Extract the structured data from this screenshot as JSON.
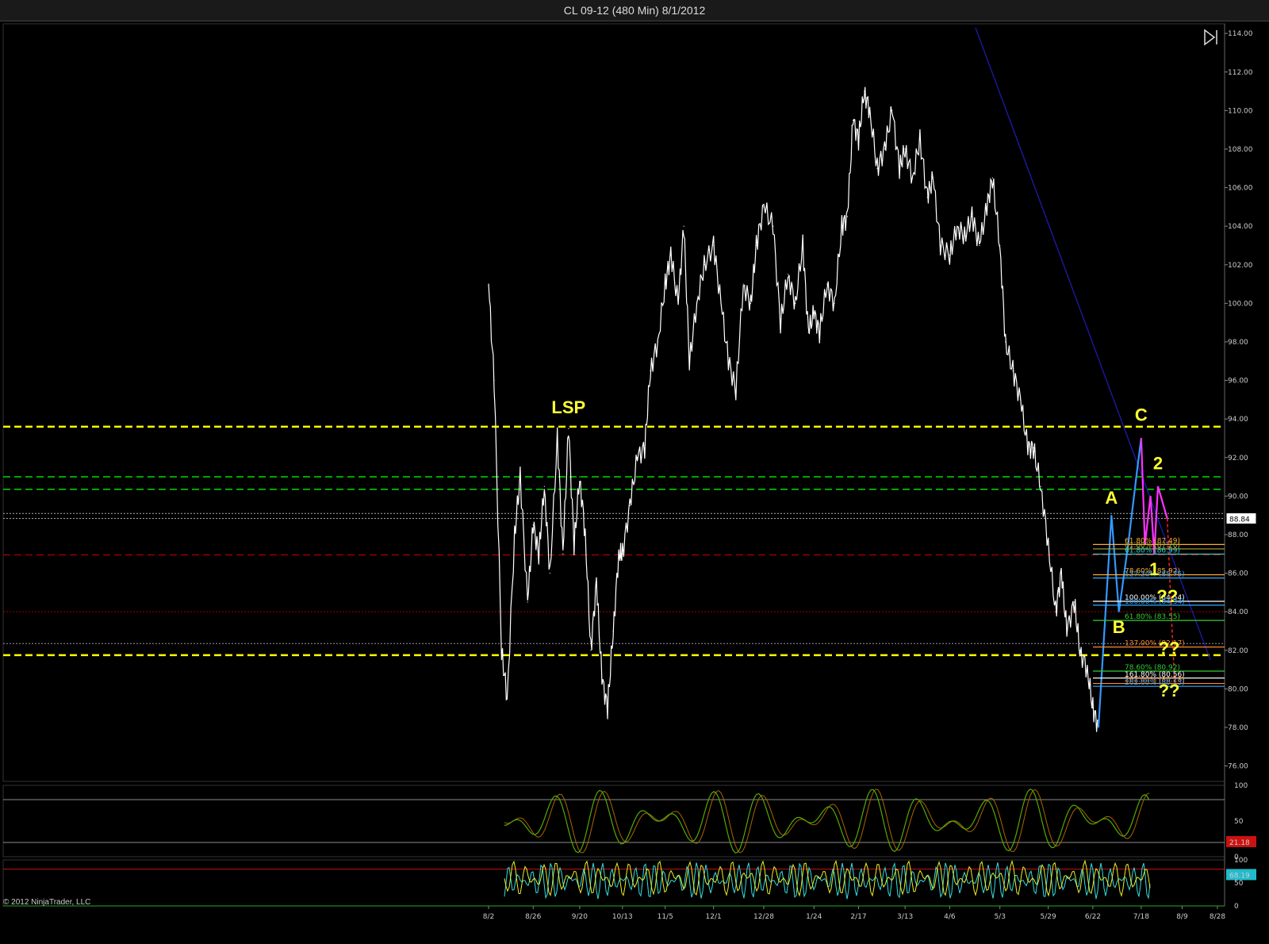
{
  "window": {
    "title": "CL 09-12 (480 Min)  8/1/2012"
  },
  "copyright": "© 2012 NinjaTrader, LLC",
  "colors": {
    "background": "#000000",
    "price": "#ffffff",
    "yellow_level": "#ffff00",
    "green_level": "#00cc00",
    "red_level": "#cc0000",
    "trendline": "#1a1aa0",
    "wave_blue": "#3399ff",
    "wave_magenta": "#ff33ff",
    "stoch_green": "#55aa00",
    "stoch_orange": "#aa6600",
    "cyan": "#33dddd"
  },
  "chart_data": [
    {
      "type": "line",
      "panel": "price",
      "x_tick_labels": [
        "8/2",
        "8/26",
        "9/20",
        "10/13",
        "11/5",
        "12/1",
        "12/28",
        "1/24",
        "2/17",
        "3/13",
        "4/6",
        "5/3",
        "5/29",
        "6/22",
        "7/18",
        "8/9",
        "8/28"
      ],
      "y_tick_labels": [
        "114.00",
        "112.00",
        "110.00",
        "108.00",
        "106.00",
        "104.00",
        "102.00",
        "100.00",
        "98.00",
        "96.00",
        "94.00",
        "92.00",
        "90.00",
        "88.00",
        "86.00",
        "84.00",
        "82.00",
        "80.00",
        "78.00",
        "76.00"
      ],
      "ylim": [
        75.2,
        114.5
      ],
      "last_price": "88.84",
      "series": [
        {
          "color": "#ffffff",
          "points": [
            [
              "8/2",
              101.0
            ],
            [
              "8/5",
              96.0
            ],
            [
              "8/9",
              82.0
            ],
            [
              "8/12",
              79.5
            ],
            [
              "8/16",
              88.0
            ],
            [
              "8/19",
              91.0
            ],
            [
              "8/23",
              84.5
            ],
            [
              "8/26",
              88.5
            ],
            [
              "8/29",
              87.0
            ],
            [
              "9/1",
              90.5
            ],
            [
              "9/4",
              86.0
            ],
            [
              "9/8",
              93.0
            ],
            [
              "9/11",
              87.0
            ],
            [
              "9/14",
              93.5
            ],
            [
              "9/17",
              87.5
            ],
            [
              "9/20",
              91.0
            ],
            [
              "9/23",
              88.0
            ],
            [
              "9/26",
              82.0
            ],
            [
              "9/29",
              85.5
            ],
            [
              "10/2",
              80.5
            ],
            [
              "10/5",
              79.0
            ],
            [
              "10/8",
              83.0
            ],
            [
              "10/11",
              87.0
            ],
            [
              "10/13",
              87.0
            ],
            [
              "10/17",
              89.5
            ],
            [
              "10/21",
              92.0
            ],
            [
              "10/25",
              92.5
            ],
            [
              "10/28",
              96.5
            ],
            [
              "11/1",
              98.0
            ],
            [
              "11/5",
              101.0
            ],
            [
              "11/8",
              102.5
            ],
            [
              "11/12",
              100.0
            ],
            [
              "11/15",
              104.0
            ],
            [
              "11/18",
              97.0
            ],
            [
              "11/22",
              100.0
            ],
            [
              "11/26",
              102.0
            ],
            [
              "12/1",
              103.0
            ],
            [
              "12/5",
              100.0
            ],
            [
              "12/9",
              97.0
            ],
            [
              "12/13",
              95.5
            ],
            [
              "12/17",
              101.0
            ],
            [
              "12/21",
              100.0
            ],
            [
              "12/24",
              103.0
            ],
            [
              "12/28",
              105.0
            ],
            [
              "1/2",
              104.0
            ],
            [
              "1/6",
              99.0
            ],
            [
              "1/10",
              101.5
            ],
            [
              "1/14",
              100.0
            ],
            [
              "1/18",
              103.0
            ],
            [
              "1/21",
              98.5
            ],
            [
              "1/24",
              99.5
            ],
            [
              "1/27",
              98.5
            ],
            [
              "1/31",
              101.0
            ],
            [
              "2/4",
              100.0
            ],
            [
              "2/8",
              104.0
            ],
            [
              "2/11",
              104.5
            ],
            [
              "2/14",
              109.5
            ],
            [
              "2/17",
              108.5
            ],
            [
              "2/20",
              111.0
            ],
            [
              "2/23",
              110.0
            ],
            [
              "2/27",
              107.0
            ],
            [
              "3/2",
              108.0
            ],
            [
              "3/6",
              110.0
            ],
            [
              "3/10",
              107.0
            ],
            [
              "3/13",
              108.0
            ],
            [
              "3/17",
              106.5
            ],
            [
              "3/21",
              108.5
            ],
            [
              "3/25",
              105.5
            ],
            [
              "3/28",
              106.5
            ],
            [
              "4/1",
              103.0
            ],
            [
              "4/6",
              102.5
            ],
            [
              "4/10",
              104.0
            ],
            [
              "4/14",
              103.5
            ],
            [
              "4/18",
              104.5
            ],
            [
              "4/22",
              103.0
            ],
            [
              "4/26",
              105.0
            ],
            [
              "4/29",
              106.5
            ],
            [
              "5/3",
              103.0
            ],
            [
              "5/6",
              98.0
            ],
            [
              "5/10",
              96.5
            ],
            [
              "5/14",
              95.0
            ],
            [
              "5/18",
              92.5
            ],
            [
              "5/21",
              92.5
            ],
            [
              "5/25",
              90.5
            ],
            [
              "5/29",
              87.5
            ],
            [
              "6/2",
              84.0
            ],
            [
              "6/5",
              86.0
            ],
            [
              "6/8",
              83.0
            ],
            [
              "6/12",
              84.5
            ],
            [
              "6/15",
              82.0
            ],
            [
              "6/19",
              81.0
            ],
            [
              "6/22",
              79.0
            ],
            [
              "6/25",
              78.0
            ]
          ]
        },
        {
          "color": "#3399ff",
          "points": [
            [
              "6/25",
              78.0
            ],
            [
              "7/2",
              89.0
            ],
            [
              "7/6",
              84.0
            ],
            [
              "7/11",
              87.5
            ],
            [
              "7/16",
              91.5
            ],
            [
              "7/18",
              93.0
            ]
          ]
        },
        {
          "color": "#ff33ff",
          "points": [
            [
              "7/18",
              93.0
            ],
            [
              "7/20",
              87.5
            ],
            [
              "7/23",
              90.0
            ],
            [
              "7/25",
              87.0
            ],
            [
              "7/27",
              90.5
            ],
            [
              "8/1",
              88.84
            ]
          ]
        }
      ],
      "horizontal_levels": [
        {
          "value": 93.6,
          "color": "#ffff00",
          "style": "dashed"
        },
        {
          "value": 91.0,
          "color": "#00cc00",
          "style": "dashed"
        },
        {
          "value": 90.35,
          "color": "#00cc00",
          "style": "dashed"
        },
        {
          "value": 89.1,
          "color": "#aaaaaa",
          "style": "dotted"
        },
        {
          "value": 88.84,
          "color": "#aaaaaa",
          "style": "dotted"
        },
        {
          "value": 86.95,
          "color": "#cc0000",
          "style": "dashed"
        },
        {
          "value": 84.0,
          "color": "#aa0000",
          "style": "dotted"
        },
        {
          "value": 82.35,
          "color": "#999999",
          "style": "dotted"
        },
        {
          "value": 81.75,
          "color": "#ffff00",
          "style": "dashed"
        }
      ],
      "annotations": [
        {
          "text": "LSP",
          "x": "9/14",
          "y": 94.3
        },
        {
          "text": "C",
          "x": "7/18",
          "y": 93.9
        },
        {
          "text": "2",
          "x": "7/27",
          "y": 91.4
        },
        {
          "text": "A",
          "x": "7/2",
          "y": 89.6
        },
        {
          "text": "1",
          "x": "7/25",
          "y": 85.9
        },
        {
          "text": "??",
          "x": "8/1",
          "y": 84.5
        },
        {
          "text": "B",
          "x": "7/6",
          "y": 82.9
        },
        {
          "text": "??",
          "x": "8/2",
          "y": 81.8
        },
        {
          "text": "??",
          "x": "8/2",
          "y": 79.6
        }
      ],
      "fib_labels": [
        {
          "text": "61.80% (87.49)",
          "y": 87.49,
          "color": "#ffaa33"
        },
        {
          "text": "61.80% (87.26)",
          "y": 87.26,
          "color": "#aaaa33"
        },
        {
          "text": "61.80% (86.99)",
          "y": 86.99,
          "color": "#33cccc"
        },
        {
          "text": "78.60% (85.92)",
          "y": 85.92,
          "color": "#ffaa33"
        },
        {
          "text": "127.20% (85.75)",
          "y": 85.75,
          "color": "#33aaff"
        },
        {
          "text": "100.00% (84.54)",
          "y": 84.54,
          "color": "#ffffff"
        },
        {
          "text": "100.00% (84.34)",
          "y": 84.34,
          "color": "#33aaff"
        },
        {
          "text": "61.80% (83.55)",
          "y": 83.55,
          "color": "#33cc33"
        },
        {
          "text": "137.00% (82.17)",
          "y": 82.17,
          "color": "#ff8833"
        },
        {
          "text": "78.60% (80.92)",
          "y": 80.92,
          "color": "#33cc33"
        },
        {
          "text": "161.80% (80.56)",
          "y": 80.56,
          "color": "#ffffff"
        },
        {
          "text": "262.00% (80.28)",
          "y": 80.28,
          "color": "#ff8833"
        },
        {
          "text": "262.00% (80.13)",
          "y": 80.13,
          "color": "#33aaff"
        }
      ]
    },
    {
      "type": "line",
      "panel": "stochastics",
      "ylim": [
        0,
        100
      ],
      "y_tick_labels": [
        "100",
        "50",
        "0"
      ],
      "last_value": "21.18",
      "levels": [
        80,
        20
      ]
    },
    {
      "type": "line",
      "panel": "oscillator",
      "ylim": [
        0,
        100
      ],
      "y_tick_labels": [
        "100",
        "50",
        "0"
      ],
      "last_value": "68.19",
      "levels": [
        80,
        0
      ]
    }
  ]
}
